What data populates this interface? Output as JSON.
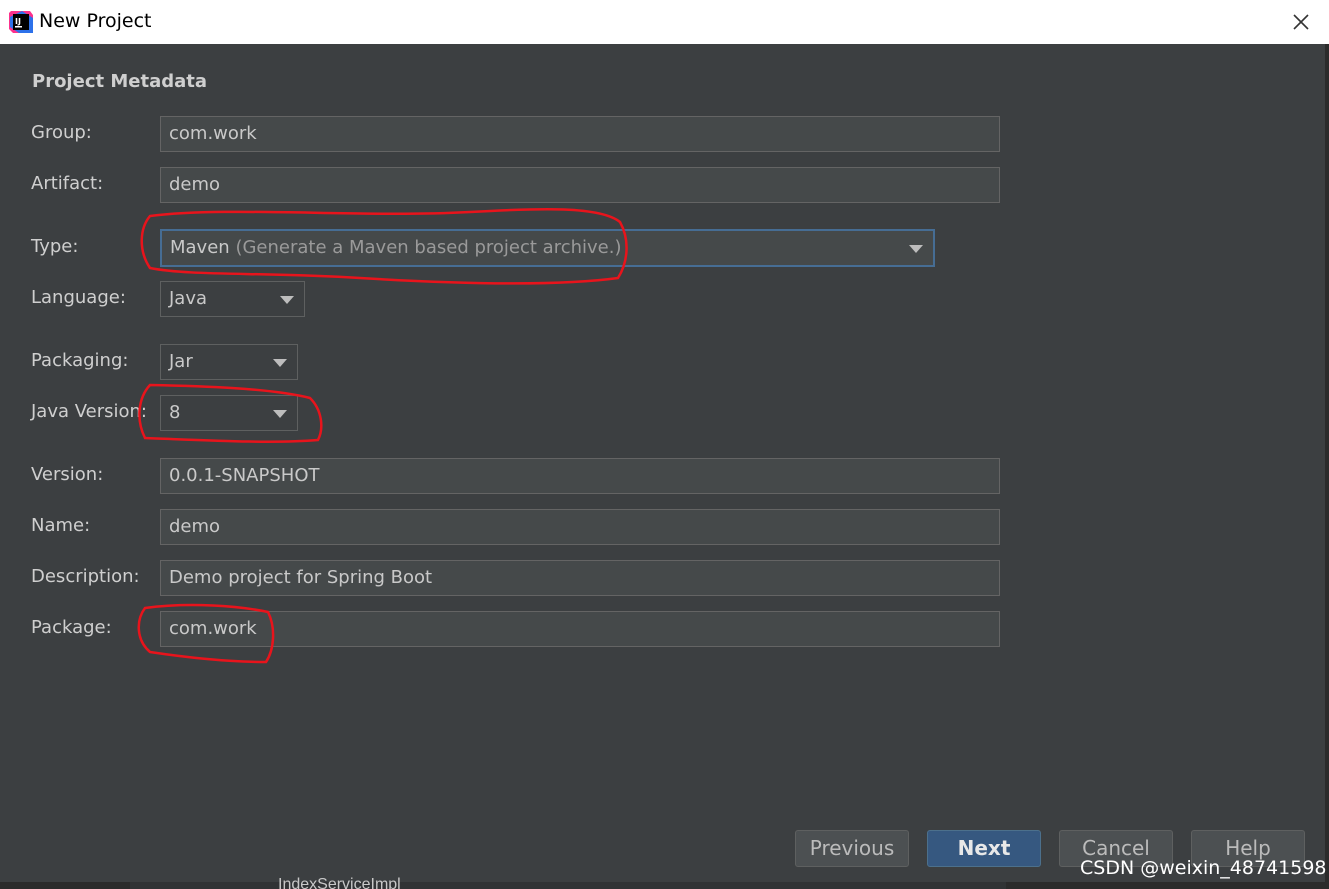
{
  "window": {
    "title": "New Project",
    "close_icon": "close-icon",
    "app_icon": "intellij-idea-icon"
  },
  "section_title": "Project Metadata",
  "fields": {
    "group": {
      "label": "Group:",
      "value": "com.work"
    },
    "artifact": {
      "label": "Artifact:",
      "value": "demo"
    },
    "type": {
      "label": "Type:",
      "value": "Maven",
      "hint": "(Generate a Maven based project archive.)"
    },
    "language": {
      "label": "Language:",
      "value": "Java"
    },
    "packaging": {
      "label": "Packaging:",
      "value": "Jar"
    },
    "java_version": {
      "label": "Java Version:",
      "value": "8"
    },
    "version": {
      "label": "Version:",
      "value": "0.0.1-SNAPSHOT"
    },
    "name": {
      "label": "Name:",
      "value": "demo"
    },
    "description": {
      "label": "Description:",
      "value": "Demo project for Spring Boot"
    },
    "package": {
      "label": "Package:",
      "value": "com.work"
    }
  },
  "buttons": {
    "previous": "Previous",
    "next": "Next",
    "cancel": "Cancel",
    "help": "Help"
  },
  "background_peek": "IndexServiceImpl",
  "watermark": "CSDN @weixin_48741598",
  "colors": {
    "background": "#3c3f41",
    "field_bg": "#45494a",
    "primary_button": "#365880",
    "focus_border": "#466d94",
    "annotation": "#e8141c"
  }
}
